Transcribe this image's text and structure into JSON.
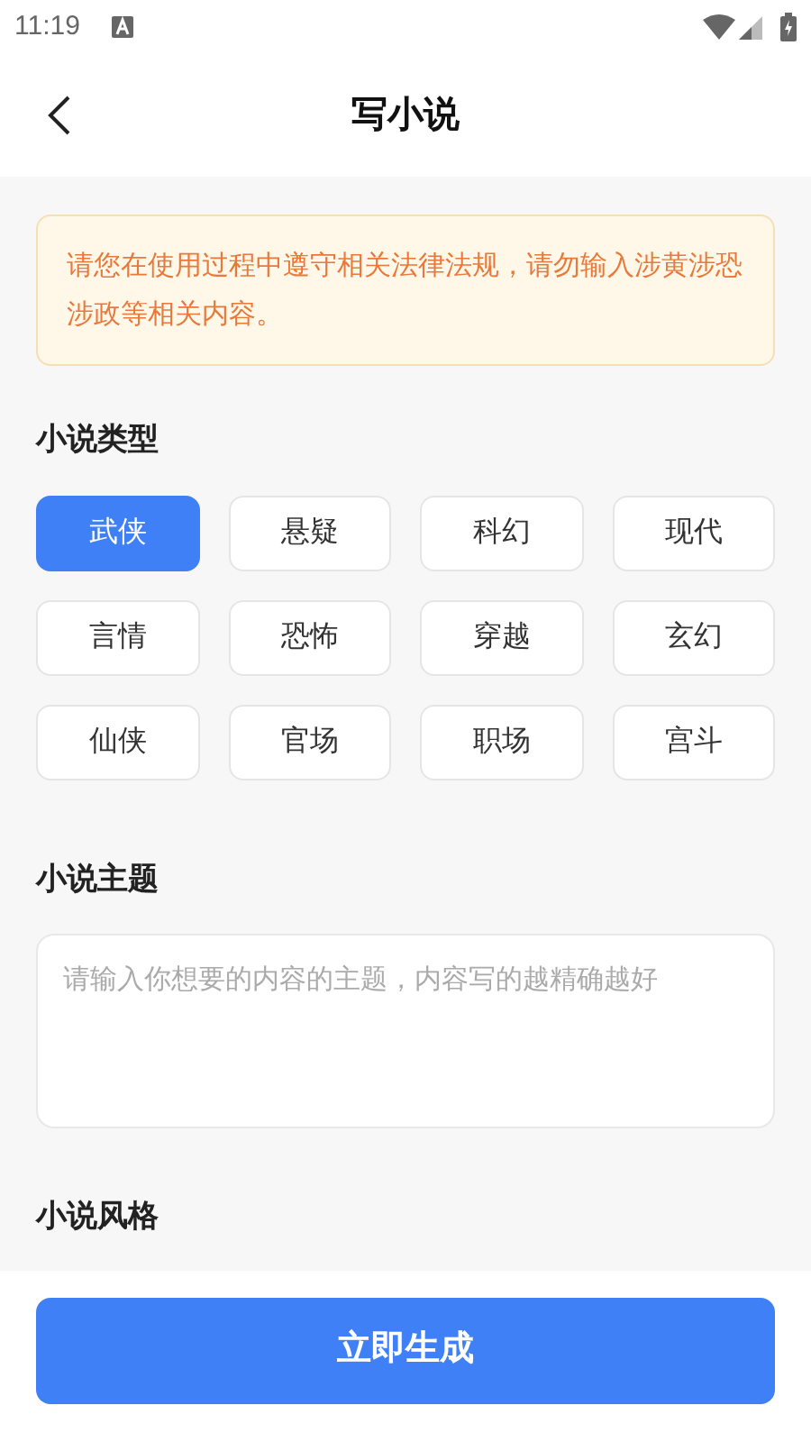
{
  "status_bar": {
    "time": "11:19"
  },
  "header": {
    "title": "写小说"
  },
  "notice": "请您在使用过程中遵守相关法律法规，请勿输入涉黄涉恐涉政等相关内容。",
  "genre_section": {
    "title": "小说类型",
    "options": [
      {
        "label": "武侠",
        "selected": true
      },
      {
        "label": "悬疑",
        "selected": false
      },
      {
        "label": "科幻",
        "selected": false
      },
      {
        "label": "现代",
        "selected": false
      },
      {
        "label": "言情",
        "selected": false
      },
      {
        "label": "恐怖",
        "selected": false
      },
      {
        "label": "穿越",
        "selected": false
      },
      {
        "label": "玄幻",
        "selected": false
      },
      {
        "label": "仙侠",
        "selected": false
      },
      {
        "label": "官场",
        "selected": false
      },
      {
        "label": "职场",
        "selected": false
      },
      {
        "label": "宫斗",
        "selected": false
      }
    ]
  },
  "theme_section": {
    "title": "小说主题",
    "placeholder": "请输入你想要的内容的主题，内容写的越精确越好"
  },
  "style_section": {
    "title": "小说风格"
  },
  "generate_button": "立即生成"
}
